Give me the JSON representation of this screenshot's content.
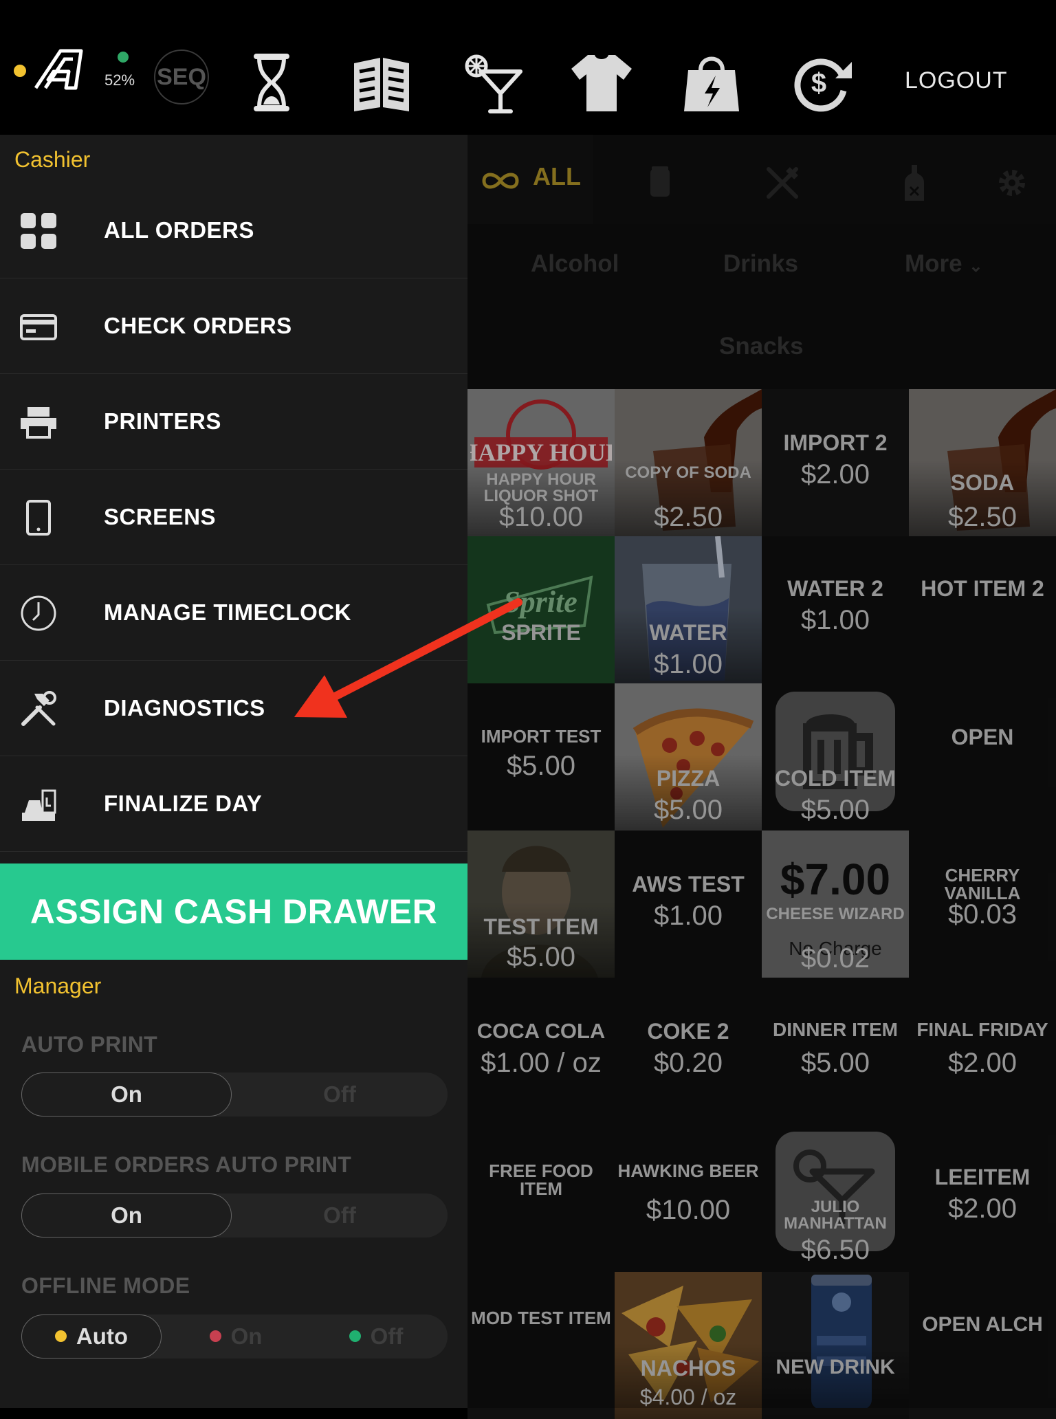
{
  "topbar": {
    "battery_percent": "52%",
    "search_text": "SEQ",
    "logout_label": "LOGOUT",
    "icons": [
      "app-logo-icon",
      "hourglass-icon",
      "menu-book-icon",
      "cocktail-icon",
      "tshirt-icon",
      "shopping-bag-icon",
      "refund-icon"
    ]
  },
  "left_panel": {
    "cashier_title": "Cashier",
    "menu": [
      {
        "label": "ALL ORDERS",
        "icon": "grid-icon"
      },
      {
        "label": "CHECK ORDERS",
        "icon": "credit-card-icon"
      },
      {
        "label": "PRINTERS",
        "icon": "printer-icon"
      },
      {
        "label": "SCREENS",
        "icon": "tablet-icon"
      },
      {
        "label": "MANAGE TIMECLOCK",
        "icon": "clock-icon"
      },
      {
        "label": "DIAGNOSTICS",
        "icon": "tools-icon"
      },
      {
        "label": "FINALIZE DAY",
        "icon": "register-icon"
      }
    ],
    "assign_cash_drawer": "ASSIGN CASH DRAWER",
    "manager_title": "Manager",
    "auto_print": {
      "label": "AUTO PRINT",
      "on": "On",
      "off": "Off",
      "selected": "On"
    },
    "mobile_auto_print": {
      "label": "MOBILE ORDERS AUTO PRINT",
      "on": "On",
      "off": "Off",
      "selected": "On"
    },
    "offline_mode": {
      "label": "OFFLINE MODE",
      "auto": "Auto",
      "on": "On",
      "off": "Off",
      "selected": "Auto"
    }
  },
  "categories": {
    "all_label": "ALL",
    "tabs": [
      "all-icon",
      "can-icon",
      "utensils-icon",
      "bottle-icon",
      "gear-icon"
    ],
    "subcategories": [
      "Alcohol",
      "Drinks",
      "More",
      "Snacks"
    ]
  },
  "products": [
    [
      {
        "name": "HAPPY HOUR LIQUOR SHOT",
        "price": "$10.00"
      },
      {
        "name": "COPY OF SODA",
        "price": "$2.50"
      },
      {
        "name": "IMPORT 2",
        "price": "$2.00"
      },
      {
        "name": "SODA",
        "price": "$2.50"
      }
    ],
    [
      {
        "name": "SPRITE",
        "price": ""
      },
      {
        "name": "WATER",
        "price": "$1.00"
      },
      {
        "name": "WATER 2",
        "price": "$1.00"
      },
      {
        "name": "HOT ITEM 2",
        "price": ""
      }
    ],
    [
      {
        "name": "IMPORT TEST",
        "price": "$5.00"
      },
      {
        "name": "PIZZA",
        "price": "$5.00"
      },
      {
        "name": "COLD ITEM",
        "price": "$5.00"
      },
      {
        "name": "OPEN",
        "price": ""
      }
    ],
    [
      {
        "name": "TEST ITEM",
        "price": "$5.00"
      },
      {
        "name": "AWS TEST",
        "price": "$1.00"
      },
      {
        "name": "CHEESE WIZARD",
        "price": "$0.02",
        "big": "$7.00",
        "overlay": "No Charge"
      },
      {
        "name": "CHERRY VANILLA",
        "price": "$0.03"
      }
    ],
    [
      {
        "name": "COCA COLA",
        "price": "$1.00 / oz"
      },
      {
        "name": "COKE 2",
        "price": "$0.20"
      },
      {
        "name": "DINNER ITEM",
        "price": "$5.00"
      },
      {
        "name": "FINAL FRIDAY",
        "price": "$2.00"
      }
    ],
    [
      {
        "name": "FREE FOOD ITEM",
        "price": ""
      },
      {
        "name": "HAWKING BEER",
        "price": "$10.00"
      },
      {
        "name": "JULIO MANHATTAN",
        "price": "$6.50"
      },
      {
        "name": "LEEITEM",
        "price": "$2.00"
      }
    ],
    [
      {
        "name": "MOD TEST ITEM",
        "price": ""
      },
      {
        "name": "NACHOS",
        "price": "$4.00 / oz"
      },
      {
        "name": "NEW DRINK",
        "price": ""
      },
      {
        "name": "OPEN ALCH",
        "price": ""
      }
    ]
  ],
  "image_text": {
    "happy_hour_stamp": "HAPPY HOUR",
    "sprite_logo": "Sprite"
  },
  "colors": {
    "accent_yellow": "#f2c230",
    "assign_green": "#27c98f",
    "arrow_red": "#f0321e"
  }
}
